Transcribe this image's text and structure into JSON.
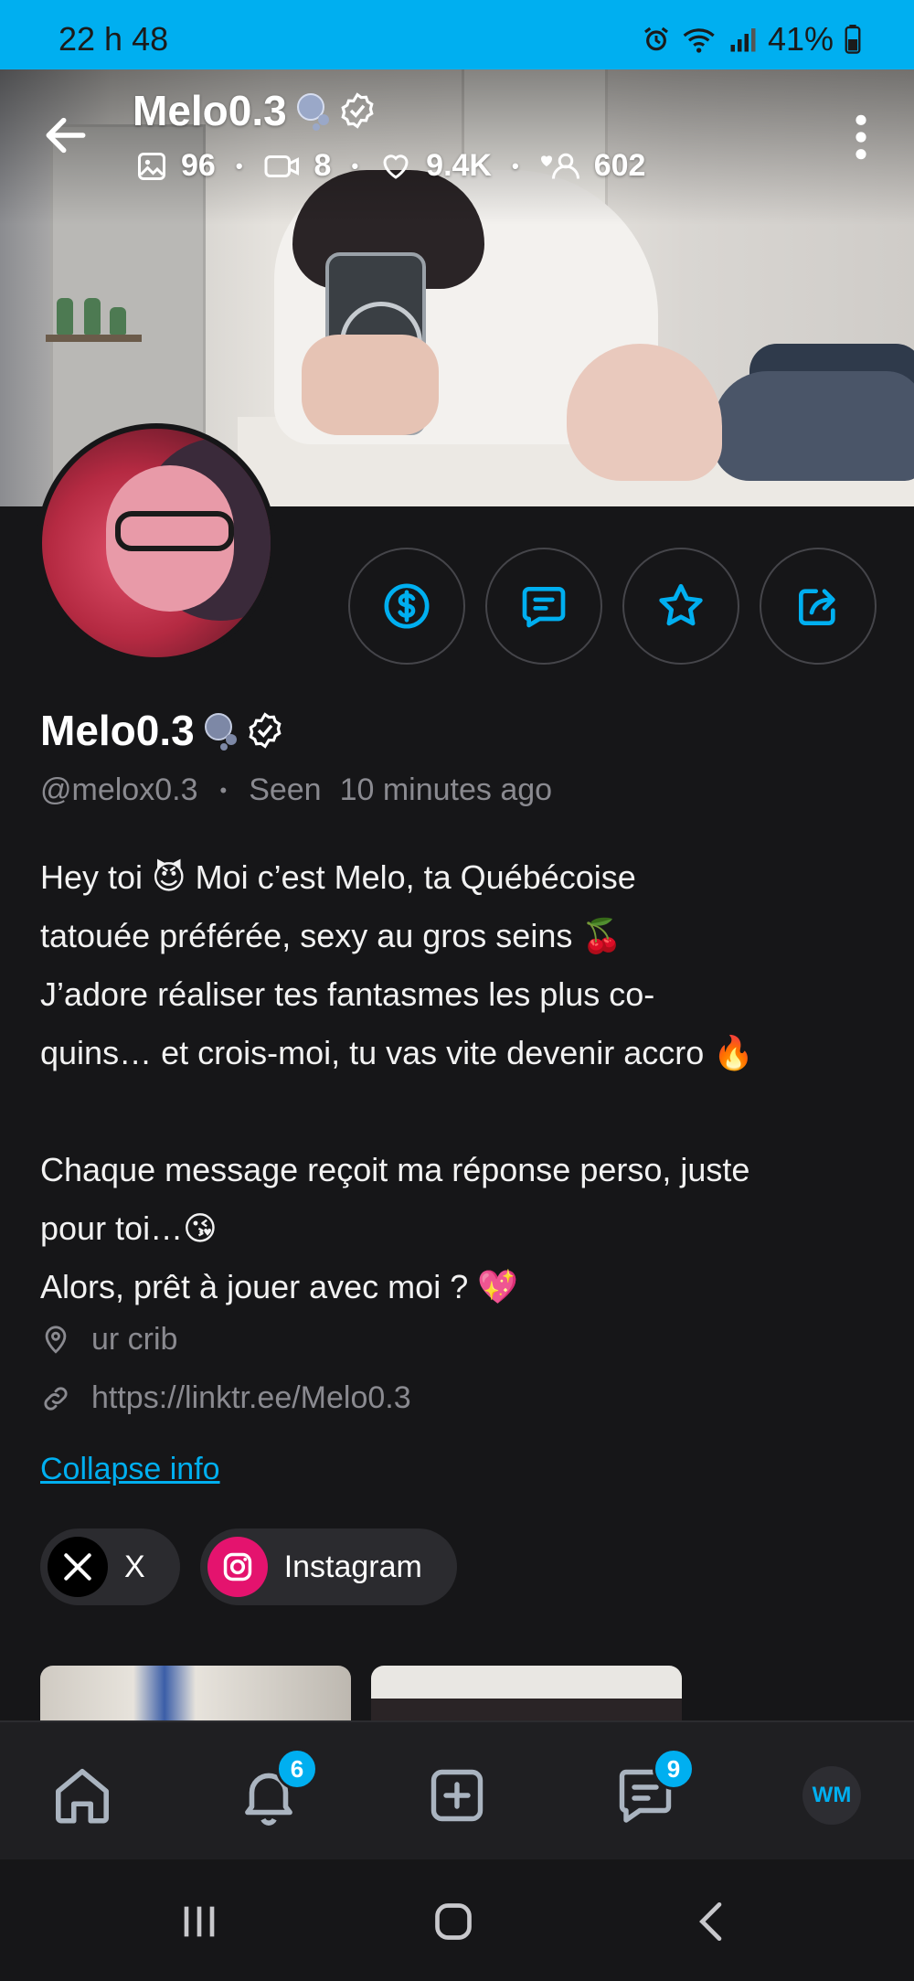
{
  "status_bar": {
    "time": "22 h 48",
    "battery": "41%",
    "accent_color": "#00AFF0"
  },
  "header": {
    "name": "Melo0.3",
    "photos_count": "96",
    "videos_count": "8",
    "likes_count": "9.4K",
    "fans_count": "602"
  },
  "profile": {
    "name": "Melo0.3",
    "handle": "@melox0.3",
    "seen_label": "Seen",
    "seen_time": "10 minutes ago",
    "bio": [
      "Hey toi 😈 Moi c’est Melo, ta Québécoise",
      "tatouée préférée, sexy au gros seins 🍒",
      "J’adore réaliser tes fantasmes les plus co-",
      "quins… et crois-moi, tu vas vite devenir accro 🔥",
      "",
      "Chaque message reçoit ma réponse perso, juste",
      "pour toi…😘",
      "Alors, prêt à jouer avec moi ? 💖"
    ],
    "location": "ur crib",
    "link": "https://linktr.ee/Melo0.3",
    "collapse_label": "Collapse info"
  },
  "socials": [
    {
      "label": "X",
      "icon": "x-icon"
    },
    {
      "label": "Instagram",
      "icon": "instagram-icon"
    }
  ],
  "actions": [
    {
      "name": "tip-button",
      "icon": "dollar-icon"
    },
    {
      "name": "message-button",
      "icon": "message-icon"
    },
    {
      "name": "favorite-button",
      "icon": "star-icon"
    },
    {
      "name": "share-button",
      "icon": "share-icon"
    }
  ],
  "bottom_nav": {
    "notifications_badge": "6",
    "messages_badge": "9",
    "avatar_initials": "WM"
  }
}
